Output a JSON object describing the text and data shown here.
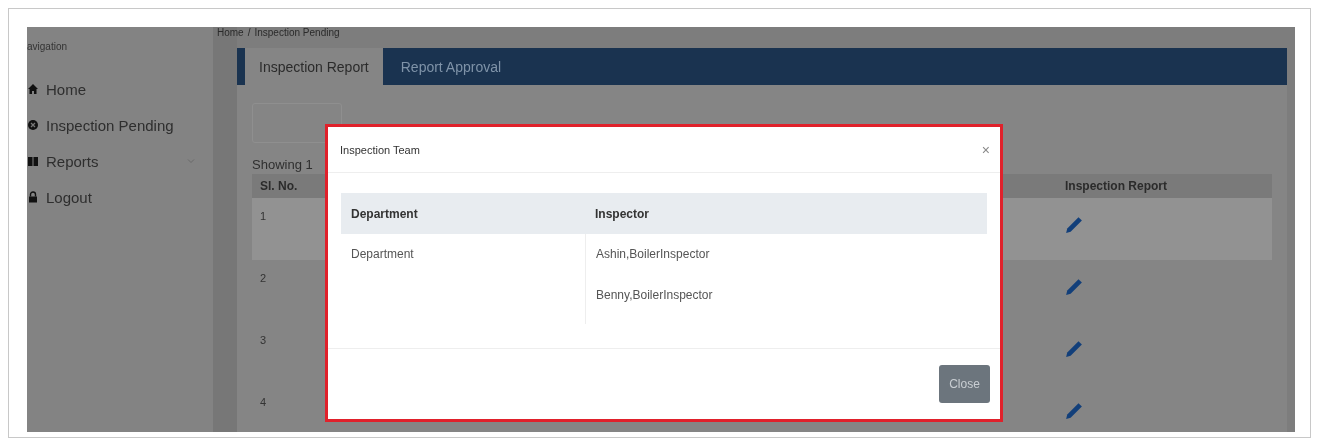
{
  "sidebar": {
    "heading": "avigation",
    "items": [
      {
        "kind": "home",
        "label": "Home",
        "expandable": false
      },
      {
        "kind": "pending",
        "label": "Inspection Pending",
        "expandable": false
      },
      {
        "kind": "reports",
        "label": "Reports",
        "expandable": true
      },
      {
        "kind": "logout",
        "label": "Logout",
        "expandable": false
      }
    ]
  },
  "breadcrumb": [
    "Home",
    "/",
    "Inspection Pending"
  ],
  "tabs": [
    {
      "label": "Inspection Report",
      "selected": true
    },
    {
      "label": "Report Approval",
      "selected": false
    }
  ],
  "showing": "Showing 1",
  "table": {
    "columns": [
      "Sl. No.",
      "Inspection Report"
    ],
    "rows": [
      {
        "sl_no": "1",
        "selected": true
      },
      {
        "sl_no": "2",
        "selected": false
      },
      {
        "sl_no": "3",
        "selected": false
      },
      {
        "sl_no": "4",
        "selected": false
      }
    ]
  },
  "modal": {
    "title": "Inspection Team",
    "close_icon": "×",
    "columns": [
      "Department",
      "Inspector"
    ],
    "rows": [
      {
        "department": "Department",
        "inspectors": [
          "Ashin,BoilerInspector",
          "Benny,BoilerInspector"
        ]
      }
    ],
    "close_button": "Close"
  }
}
